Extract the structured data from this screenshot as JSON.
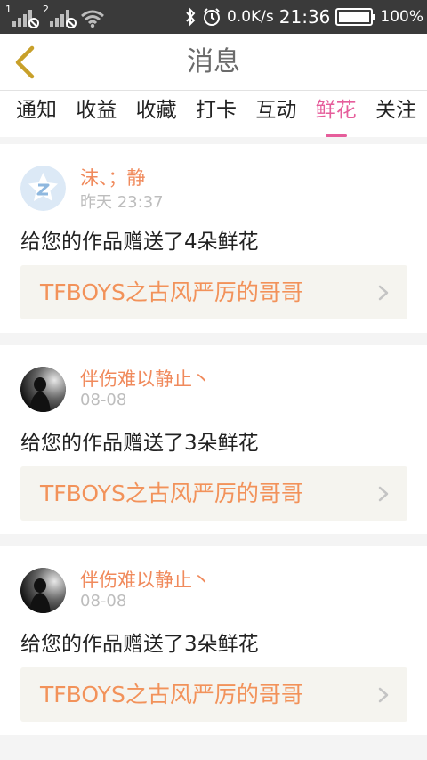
{
  "status_bar": {
    "sim1": "1",
    "sim2": "2",
    "net_speed": "0.0K/s",
    "time": "21:36",
    "battery": "100%"
  },
  "header": {
    "title": "消息"
  },
  "tabs": [
    {
      "label": "通知",
      "active": false
    },
    {
      "label": "收益",
      "active": false
    },
    {
      "label": "收藏",
      "active": false
    },
    {
      "label": "打卡",
      "active": false
    },
    {
      "label": "互动",
      "active": false
    },
    {
      "label": "鲜花",
      "active": true
    },
    {
      "label": "关注",
      "active": false
    }
  ],
  "colors": {
    "accent": "#e65d9b",
    "username": "#f08a5c",
    "work_title": "#f2925a"
  },
  "feed": [
    {
      "username": "沫、；静",
      "time": "昨天 23:37",
      "message": "给您的作品赠送了4朵鲜花",
      "work_title": "TFBOYS之古风严厉的哥哥",
      "avatar": "qzone-avatar-icon"
    },
    {
      "username": "伴伤难以静止丶",
      "time": "08-08",
      "message": "给您的作品赠送了3朵鲜花",
      "work_title": "TFBOYS之古风严厉的哥哥",
      "avatar": "dark-photo-avatar"
    },
    {
      "username": "伴伤难以静止丶",
      "time": "08-08",
      "message": "给您的作品赠送了3朵鲜花",
      "work_title": "TFBOYS之古风严厉的哥哥",
      "avatar": "dark-photo-avatar"
    }
  ]
}
